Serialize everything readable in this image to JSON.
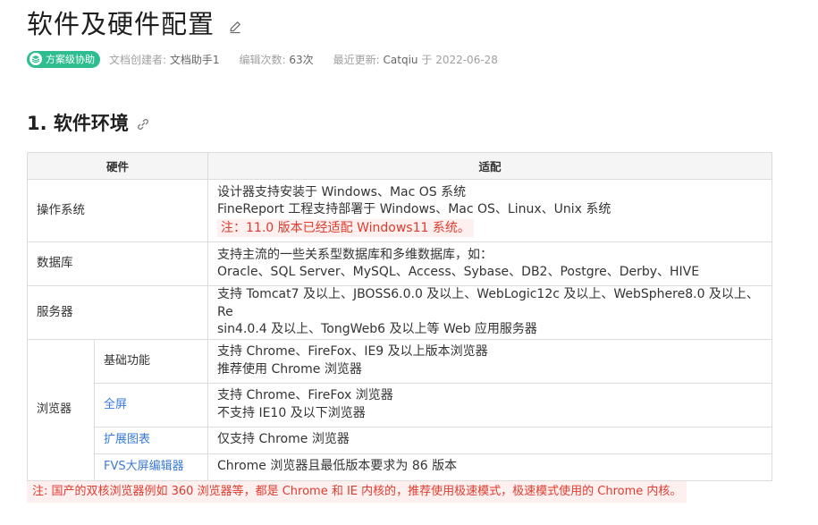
{
  "page": {
    "title": "软件及硬件配置"
  },
  "meta": {
    "badge_label": "方案级协助",
    "creator_label": "文档创建者:",
    "creator_value": "文档助手1",
    "edits_label": "编辑次数:",
    "edits_value": "63次",
    "updated_label": "最近更新:",
    "updated_by": "Catqiu",
    "updated_on": "于 2022-06-28"
  },
  "section": {
    "heading": "1. 软件环境"
  },
  "table": {
    "header_hardware": "硬件",
    "header_adapt": "适配",
    "os": {
      "label": "操作系统",
      "line1": "设计器支持安装于 Windows、Mac OS 系统",
      "line2": "FineReport 工程支持部署于 Windows、Mac OS、Linux、Unix 系统",
      "note": "注：11.0 版本已经适配 Windows11 系统。"
    },
    "db": {
      "label": "数据库",
      "line1": "支持主流的一些关系型数据库和多维数据库，如：",
      "line2": "Oracle、SQL Server、MySQL、Access、Sybase、DB2、Postgre、Derby、HIVE"
    },
    "server": {
      "label": "服务器",
      "line1": "支持 Tomcat7 及以上、JBOSS6.0.0 及以上、WebLogic12c 及以上、WebSphere8.0 及以上、Re",
      "line2": "sin4.0.4 及以上、TongWeb6 及以上等 Web 应用服务器"
    },
    "browser": {
      "label": "浏览器",
      "basic": {
        "label": "基础功能",
        "line1": "支持 Chrome、FireFox、IE9 及以上版本浏览器",
        "line2": "推荐使用 Chrome 浏览器"
      },
      "fullscreen": {
        "label": "全屏",
        "line1": "支持 Chrome、FireFox 浏览器",
        "line2": "不支持 IE10 及以下浏览器"
      },
      "extchart": {
        "label": "扩展图表",
        "line1": "仅支持 Chrome 浏览器"
      },
      "fvs": {
        "label": "FVS大屏编辑器",
        "line1": "Chrome 浏览器且最低版本要求为 86 版本"
      }
    }
  },
  "footer": {
    "note": "注: 国产的双核浏览器例如 360 浏览器等，都是 Chrome 和 IE 内核的，推荐使用极速模式，极速模式使用的 Chrome 内核。"
  },
  "colors": {
    "accent_green": "#2dbd8e",
    "link_blue": "#3a7bd5",
    "note_red": "#e03b2e",
    "note_bg": "#fdf0ef"
  },
  "icons": {
    "edit": "pencil-icon",
    "link": "link-icon",
    "badge": "layers-icon"
  }
}
